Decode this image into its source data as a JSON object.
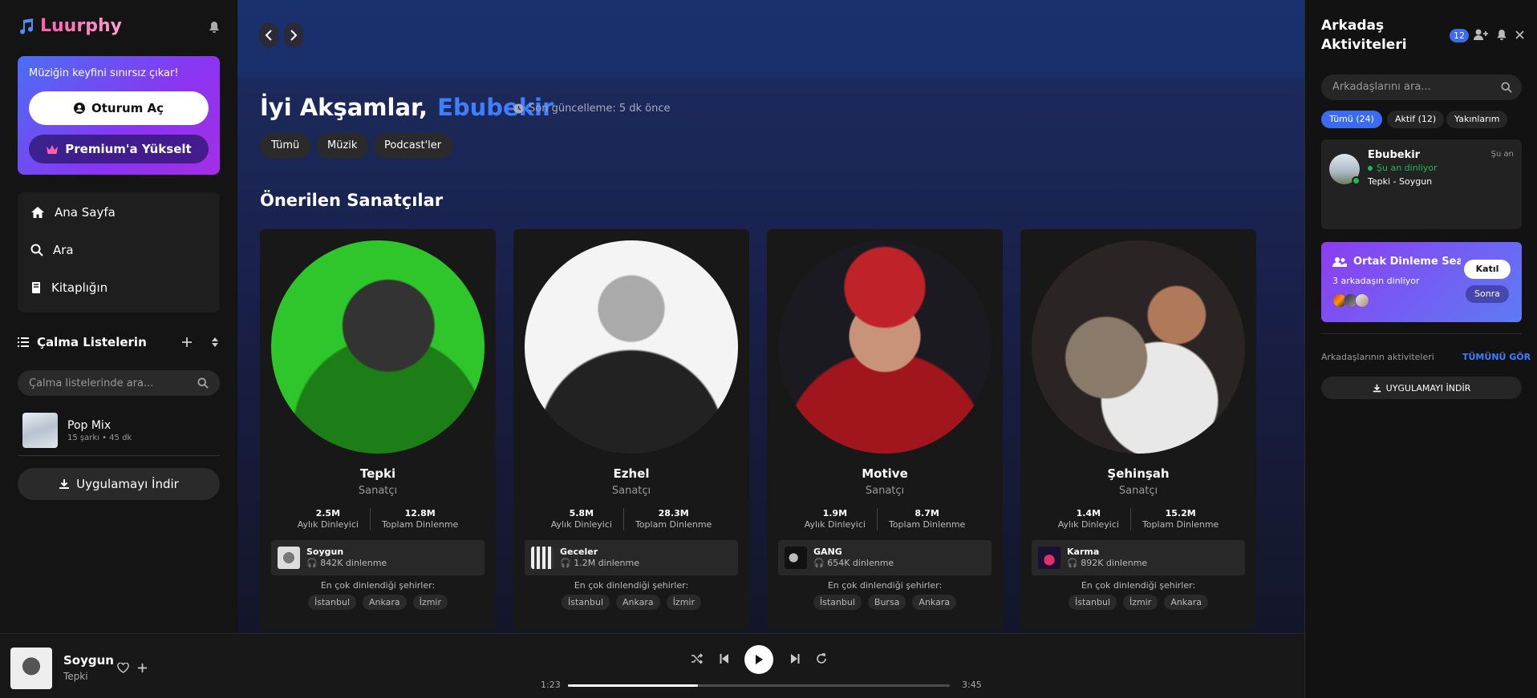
{
  "app": {
    "name": "Luurphy"
  },
  "sidebar": {
    "promo_text": "Müziğin keyfini sınırsız çıkar!",
    "login_label": "Oturum Aç",
    "premium_label": "Premium'a Yükselt",
    "nav": [
      {
        "label": "Ana Sayfa",
        "icon": "home-icon"
      },
      {
        "label": "Ara",
        "icon": "search-icon"
      },
      {
        "label": "Kitaplığın",
        "icon": "library-icon"
      }
    ],
    "playlists_title": "Çalma Listelerin",
    "playlist_search_placeholder": "Çalma listelerinde ara...",
    "playlists": [
      {
        "name": "Pop Mix",
        "meta": "15 şarkı • 45 dk"
      }
    ],
    "download_label": "Uygulamayı İndir"
  },
  "main": {
    "greeting": "İyi Akşamlar,",
    "user_name": "Ebubekir",
    "last_update": "Son güncelleme: 5 dk önce",
    "filters": [
      "Tümü",
      "Müzik",
      "Podcast'ler"
    ],
    "section_title": "Önerilen Sanatçılar",
    "stat_labels": {
      "monthly": "Aylık Dinleyici",
      "total": "Toplam Dinlenme"
    },
    "cities_label": "En çok dinlendiği şehirler:",
    "artists": [
      {
        "name": "Tepki",
        "role": "Sanatçı",
        "monthly": "2.5M",
        "total": "12.8M",
        "song": "Soygun",
        "plays": "842K dinlenme",
        "cities": [
          "İstanbul",
          "Ankara",
          "İzmir"
        ]
      },
      {
        "name": "Ezhel",
        "role": "Sanatçı",
        "monthly": "5.8M",
        "total": "28.3M",
        "song": "Geceler",
        "plays": "1.2M dinlenme",
        "cities": [
          "İstanbul",
          "Ankara",
          "İzmir"
        ]
      },
      {
        "name": "Motive",
        "role": "Sanatçı",
        "monthly": "1.9M",
        "total": "8.7M",
        "song": "GANG",
        "plays": "654K dinlenme",
        "cities": [
          "İstanbul",
          "Bursa",
          "Ankara"
        ]
      },
      {
        "name": "Şehinşah",
        "role": "Sanatçı",
        "monthly": "1.4M",
        "total": "15.2M",
        "song": "Karma",
        "plays": "892K dinlenme",
        "cities": [
          "İstanbul",
          "İzmir",
          "Ankara"
        ]
      }
    ]
  },
  "right": {
    "title": "Arkadaş Aktiviteleri",
    "badge": "12",
    "search_placeholder": "Arkadaşlarını ara...",
    "chips": [
      "Tümü (24)",
      "Aktif (12)",
      "Yakınlarım"
    ],
    "friend": {
      "name": "Ebubekir",
      "status": "Şu an dinliyor",
      "track": "Tepki - Soygun",
      "time": "Şu an"
    },
    "session": {
      "title": "Ortak Dinleme Seansı",
      "subtitle": "3 arkadaşın dinliyor",
      "join": "Katıl",
      "later": "Sonra"
    },
    "activity_label": "Arkadaşlarının aktiviteleri",
    "see_all": "TÜMÜNÜ GÖR",
    "download": "UYGULAMAYI İNDİR"
  },
  "player": {
    "title": "Soygun",
    "artist": "Tepki",
    "elapsed": "1:23",
    "duration": "3:45",
    "progress": 0.34
  },
  "colors": {
    "accent": "#3f7fff",
    "brand": "#ff6fb8",
    "online": "#1db954"
  }
}
